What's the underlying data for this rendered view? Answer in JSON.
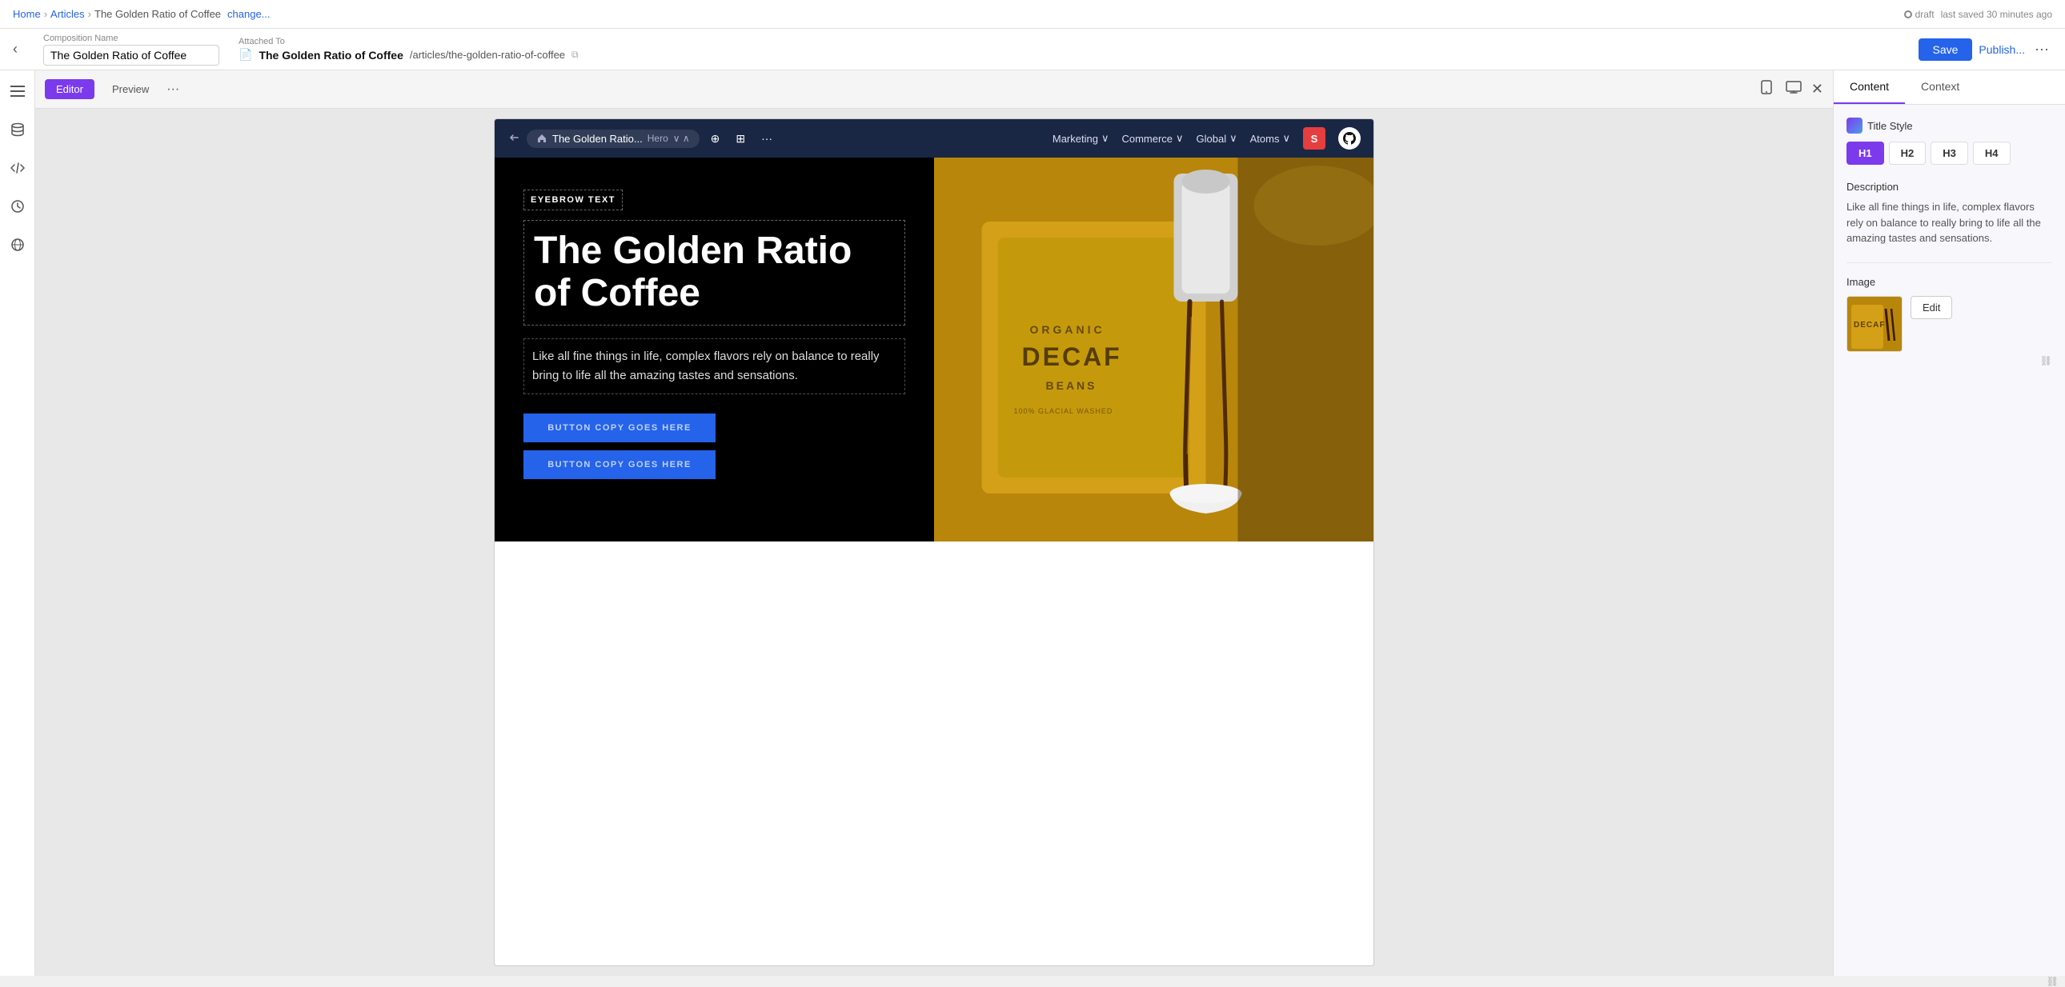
{
  "topbar": {
    "breadcrumb": {
      "home": "Home",
      "articles": "Articles",
      "page": "The Golden Ratio of Coffee",
      "change": "change..."
    },
    "draft_label": "draft",
    "last_saved": "last saved 30 minutes ago"
  },
  "composition_bar": {
    "comp_name_label": "Composition Name",
    "comp_name_value": "The Golden Ratio of Coffee",
    "attached_to_label": "Attached To",
    "attached_doc_name": "The Golden Ratio of Coffee",
    "attached_url": "/articles/the-golden-ratio-of-coffee",
    "save_btn": "Save",
    "publish_btn": "Publish...",
    "more_btn": "···"
  },
  "editor_toolbar": {
    "tab_editor": "Editor",
    "tab_preview": "Preview",
    "more_btn": "···"
  },
  "canvas_nav": {
    "comp_name": "The Golden Ratio...",
    "comp_type": "Hero",
    "nav_items": [
      {
        "label": "Marketing",
        "has_arrow": true
      },
      {
        "label": "Commerce",
        "has_arrow": true
      },
      {
        "label": "Global",
        "has_arrow": true
      },
      {
        "label": "Atoms",
        "has_arrow": true
      }
    ]
  },
  "hero": {
    "eyebrow": "EYEBROW TEXT",
    "title": "The Golden Ratio of Coffee",
    "description": "Like all fine things in life, complex flavors rely on balance to really bring to life all the amazing tastes and sensations.",
    "button1": "BUTTON COPY GOES HERE",
    "button2": "BUTTON COPY GOES HERE",
    "decaf_text": "DECAF",
    "decaf_sub": "BEANS"
  },
  "right_panel": {
    "tabs": [
      {
        "label": "Content",
        "active": true
      },
      {
        "label": "Context",
        "active": false
      }
    ],
    "title_style_label": "Title Style",
    "heading_buttons": [
      {
        "label": "H1",
        "active": true
      },
      {
        "label": "H2",
        "active": false
      },
      {
        "label": "H3",
        "active": false
      },
      {
        "label": "H4",
        "active": false
      }
    ],
    "description_label": "Description",
    "description_text": "Like all fine things in life, complex flavors rely on balance to really bring to life all the amazing tastes and sensations.",
    "image_label": "Image",
    "edit_btn": "Edit"
  }
}
